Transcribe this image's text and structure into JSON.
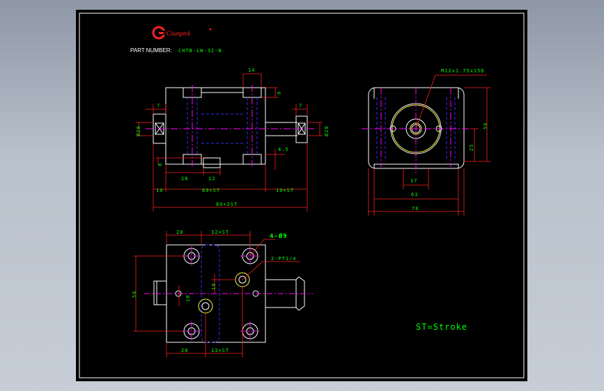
{
  "brand": {
    "logo_text": "Clamptek",
    "logo_mark": "registered"
  },
  "part_number": {
    "label": "PART NUMBER:",
    "value": "CHTB-LW-32-N"
  },
  "note": "ST=Stroke",
  "dims_side": {
    "d14": "14",
    "d9": "9",
    "d7_left": "7",
    "d7_right": "7",
    "dia_left": "Ø20",
    "dia_right": "Ø20",
    "d4_5": "4.5",
    "d8": "8",
    "d28": "28",
    "d12": "12",
    "d10": "10",
    "d69": "69+ST",
    "d10st": "10+ST",
    "d89": "89+2ST"
  },
  "dims_end": {
    "thread": "M12x1.75x15D",
    "d56": "56",
    "d25": "25",
    "d17": "17",
    "d63": "63",
    "d70": "70"
  },
  "dims_top": {
    "d20": "20",
    "d32": "32+ST",
    "holes": "4-Ø9",
    "port": "2-PT1/4",
    "d10a": "10",
    "d10b": "10",
    "d56": "56",
    "d28": "28",
    "d13": "13+ST"
  },
  "colors": {
    "outline": "#ffffff",
    "dimension": "#ff2020",
    "dim_text": "#00ff00",
    "centerline": "#ff00ff",
    "hidden": "#3030ff",
    "thread": "#ffff40",
    "brand": "#ff2020"
  }
}
